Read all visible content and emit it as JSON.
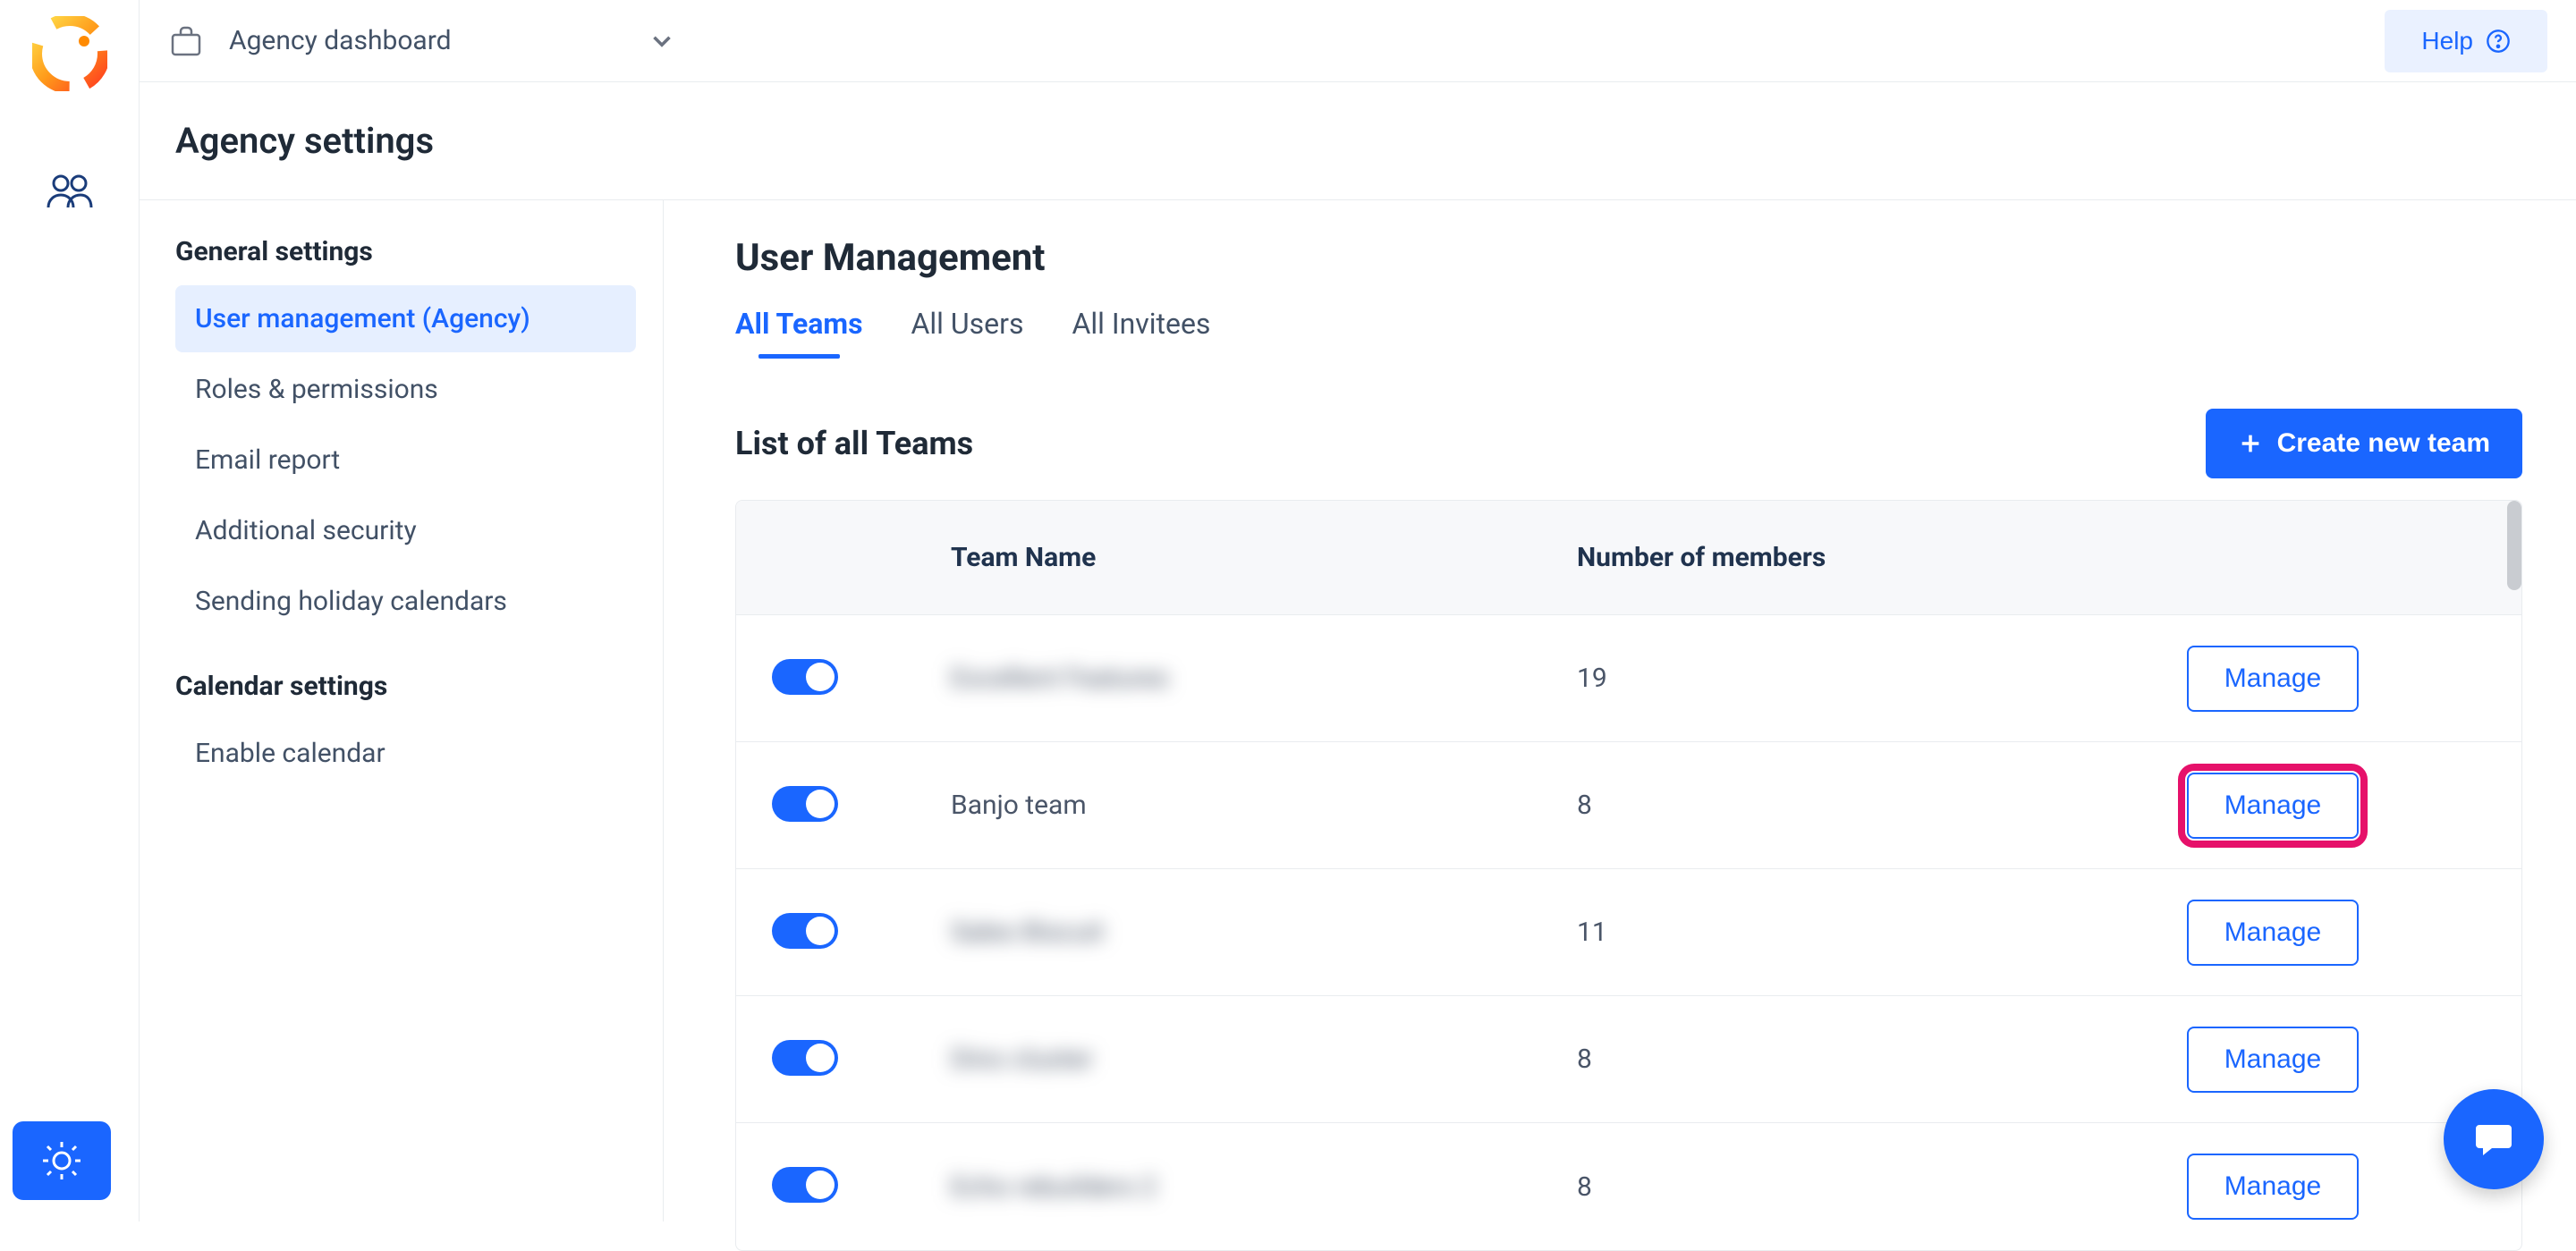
{
  "topbar": {
    "dashboard_label": "Agency dashboard",
    "help_label": "Help"
  },
  "page": {
    "title": "Agency settings"
  },
  "sidenav": {
    "section1_title": "General settings",
    "section1_items": [
      "User management (Agency)",
      "Roles & permissions",
      "Email report",
      "Additional security",
      "Sending holiday calendars"
    ],
    "section1_active_index": 0,
    "section2_title": "Calendar settings",
    "section2_items": [
      "Enable calendar"
    ]
  },
  "main": {
    "heading": "User Management",
    "tabs": [
      "All Teams",
      "All Users",
      "All Invitees"
    ],
    "active_tab_index": 0,
    "list_title": "List of all Teams",
    "create_label": "Create new team",
    "columns": {
      "name": "Team Name",
      "members": "Number of members"
    },
    "manage_label": "Manage",
    "highlight_row_index": 1,
    "rows": [
      {
        "toggle": true,
        "name": "Excellent Features",
        "members": "19",
        "blurred": true
      },
      {
        "toggle": true,
        "name": "Banjo team",
        "members": "8",
        "blurred": false
      },
      {
        "toggle": true,
        "name": "Sales Biscuit",
        "members": "11",
        "blurred": true
      },
      {
        "toggle": true,
        "name": "Dino cluster",
        "members": "8",
        "blurred": true
      },
      {
        "toggle": true,
        "name": "Echo rebuilders 2",
        "members": "8",
        "blurred": true
      }
    ]
  }
}
